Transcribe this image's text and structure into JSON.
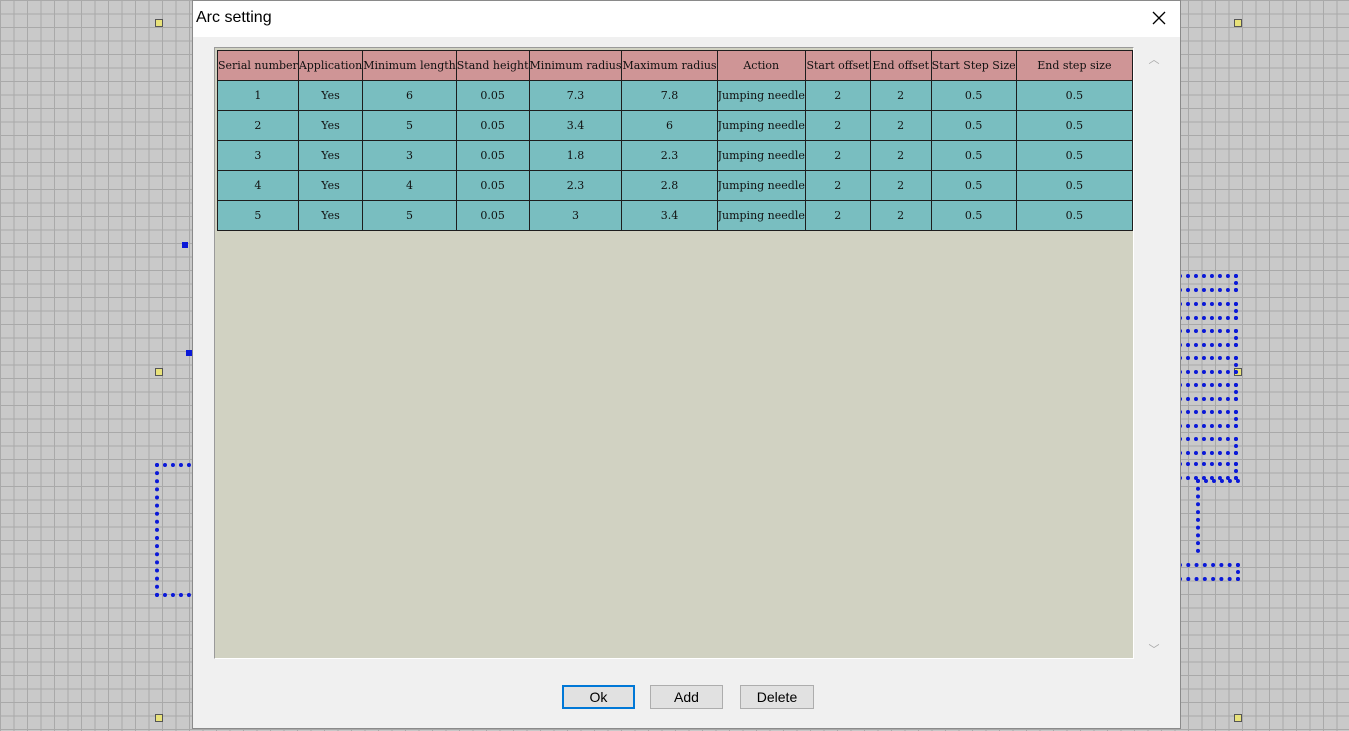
{
  "dialog": {
    "title": "Arc setting",
    "close_glyph": "✕"
  },
  "table": {
    "headers": [
      "Serial number",
      "Application",
      "Minimum length",
      "Stand height",
      "Minimum radius",
      "Maximum radius",
      "Action",
      "Start offset",
      "End offset",
      "Start Step Size",
      "End step size"
    ],
    "rows": [
      [
        "1",
        "Yes",
        "6",
        "0.05",
        "7.3",
        "7.8",
        "Jumping needle",
        "2",
        "2",
        "0.5",
        "0.5"
      ],
      [
        "2",
        "Yes",
        "5",
        "0.05",
        "3.4",
        "6",
        "Jumping needle",
        "2",
        "2",
        "0.5",
        "0.5"
      ],
      [
        "3",
        "Yes",
        "3",
        "0.05",
        "1.8",
        "2.3",
        "Jumping needle",
        "2",
        "2",
        "0.5",
        "0.5"
      ],
      [
        "4",
        "Yes",
        "4",
        "0.05",
        "2.3",
        "2.8",
        "Jumping needle",
        "2",
        "2",
        "0.5",
        "0.5"
      ],
      [
        "5",
        "Yes",
        "5",
        "0.05",
        "3",
        "3.4",
        "Jumping needle",
        "2",
        "2",
        "0.5",
        "0.5"
      ]
    ]
  },
  "buttons": {
    "ok": "Ok",
    "add": "Add",
    "delete": "Delete"
  },
  "scrollbar": {
    "up_glyph": "︿",
    "down_glyph": "﹀"
  }
}
